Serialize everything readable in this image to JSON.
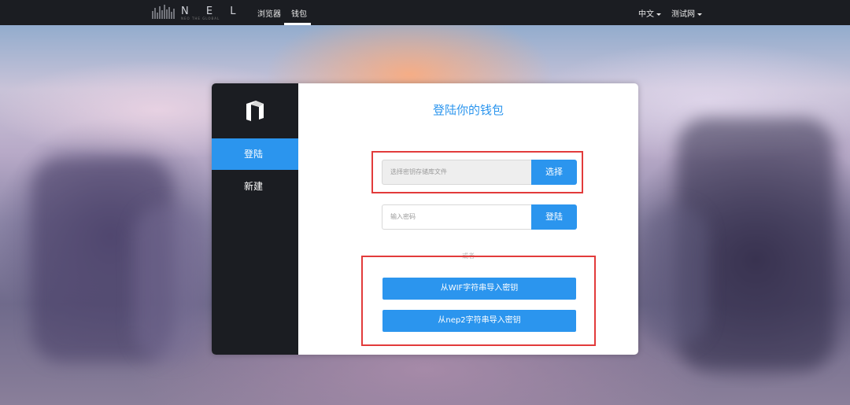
{
  "nav": {
    "logo_text": "N E L",
    "logo_subtext": "NEO THE GLOBAL",
    "links": [
      "浏览器",
      "钱包"
    ],
    "active_link": "钱包",
    "language": "中文",
    "network": "测试网"
  },
  "sidebar": {
    "items": [
      {
        "label": "登陆",
        "active": true
      },
      {
        "label": "新建",
        "active": false
      }
    ]
  },
  "panel": {
    "title": "登陆你的钱包",
    "file_placeholder": "选择密钥存储库文件",
    "file_button": "选择",
    "password_placeholder": "输入密码",
    "login_button": "登陆",
    "or_text": "或者",
    "wif_button": "从WIF字符串导入密钥",
    "nep2_button": "从nep2字符串导入密钥"
  },
  "colors": {
    "accent": "#2b95ee",
    "nav_bg": "#1b1d22",
    "highlight": "#e23b3b"
  }
}
